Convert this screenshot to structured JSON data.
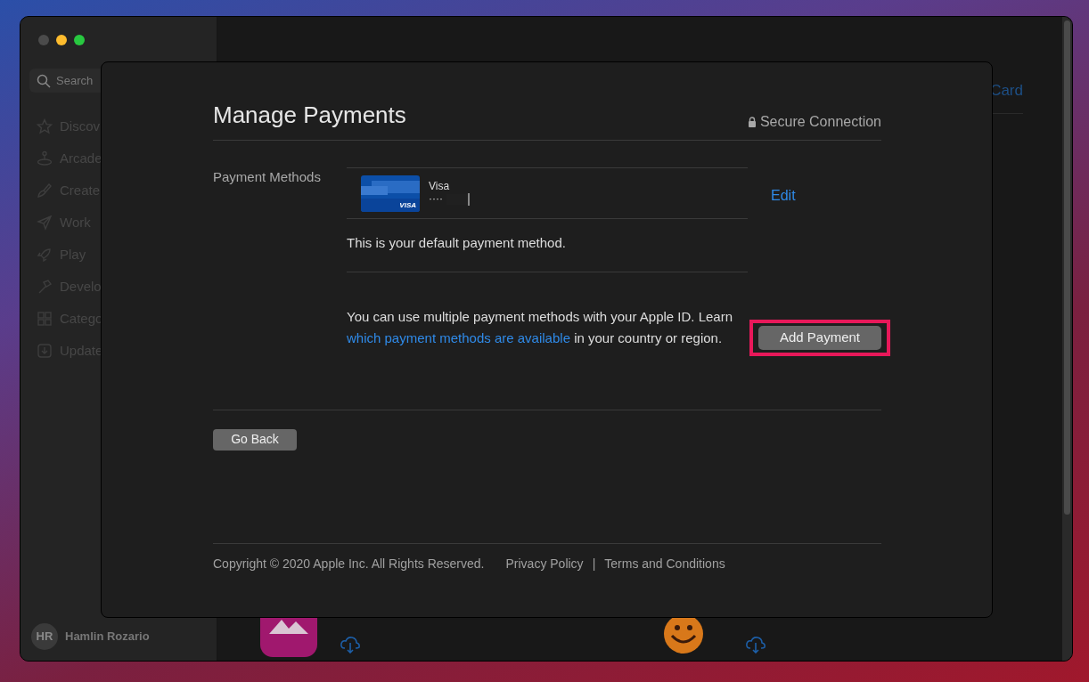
{
  "window": {
    "controls": [
      {
        "color": "#4b4b4b"
      },
      {
        "color": "#febc2e"
      },
      {
        "color": "#28c840"
      }
    ]
  },
  "sidebar": {
    "search": {
      "placeholder": "Search"
    },
    "items": [
      {
        "label": "Discov"
      },
      {
        "label": "Arcade"
      },
      {
        "label": "Create"
      },
      {
        "label": "Work"
      },
      {
        "label": "Play"
      },
      {
        "label": "Develo"
      },
      {
        "label": "Catego"
      },
      {
        "label": "Update"
      }
    ],
    "user": {
      "initials": "HR",
      "name": "Hamlin Rozario"
    }
  },
  "main": {
    "link": "Card"
  },
  "modal": {
    "title": "Manage Payments",
    "secure": "Secure Connection",
    "section_label": "Payment Methods",
    "card": {
      "logo_text": "VISA",
      "brand": "Visa",
      "number": "····"
    },
    "edit": "Edit",
    "default_note": "This is your default payment method.",
    "info": {
      "before": "You can use multiple payment methods with your Apple ID. Learn ",
      "link": "which payment methods are available",
      "after": " in your country or region."
    },
    "add_button": {
      "label": "Add Payment",
      "highlighted": true
    },
    "go_back": "Go Back",
    "footer": {
      "copyright": "Copyright © 2020 Apple Inc. All Rights Reserved.",
      "links": [
        "Privacy Policy",
        "Terms and Conditions"
      ],
      "separator": "|"
    }
  }
}
